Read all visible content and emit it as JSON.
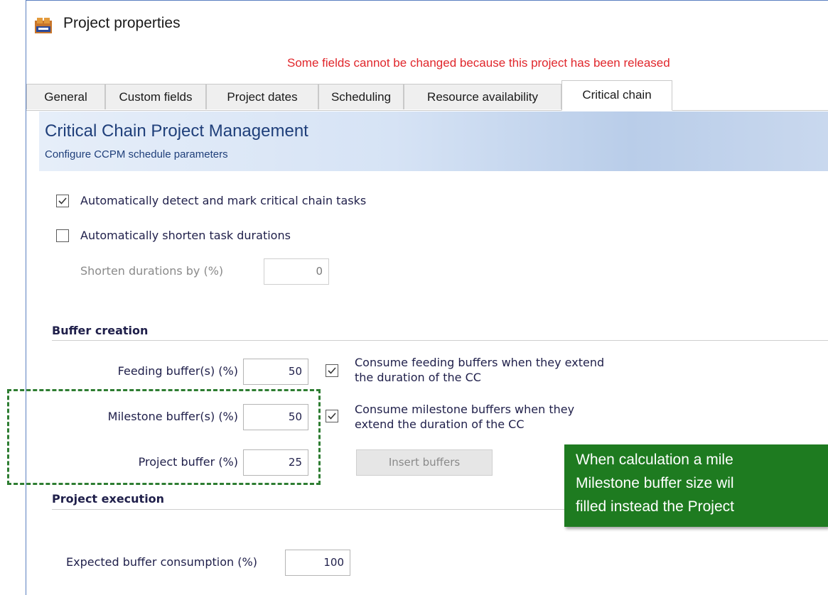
{
  "window": {
    "title": "Project properties",
    "warning": "Some fields cannot be changed because this project has been released"
  },
  "tabs": [
    {
      "label": "General",
      "active": false
    },
    {
      "label": "Custom fields",
      "active": false
    },
    {
      "label": "Project dates",
      "active": false
    },
    {
      "label": "Scheduling",
      "active": false
    },
    {
      "label": "Resource availability",
      "active": false
    },
    {
      "label": "Critical chain",
      "active": true
    }
  ],
  "banner": {
    "title": "Critical Chain Project Management",
    "subtitle": "Configure CCPM schedule parameters"
  },
  "options": {
    "auto_detect": {
      "label": "Automatically detect and mark critical chain tasks",
      "checked": true
    },
    "auto_shorten": {
      "label": "Automatically shorten task durations",
      "checked": false
    },
    "shorten_by": {
      "label": "Shorten durations by (%)",
      "value": "0"
    }
  },
  "buffer_creation": {
    "heading": "Buffer creation",
    "feeding": {
      "label": "Feeding buffer(s) (%)",
      "value": "50"
    },
    "milestone": {
      "label": "Milestone buffer(s) (%)",
      "value": "50"
    },
    "project": {
      "label": "Project buffer (%)",
      "value": "25"
    },
    "consume_feeding": {
      "line1": "Consume feeding buffers when they extend",
      "line2": "the duration of the CC",
      "checked": true
    },
    "consume_milestone": {
      "line1": "Consume milestone buffers when they",
      "line2": "extend the duration of the CC",
      "checked": true
    },
    "insert_buttons_label": "Insert buffers"
  },
  "project_execution": {
    "heading": "Project execution",
    "expected": {
      "label": "Expected buffer consumption (%)",
      "value": "100"
    }
  },
  "callout": {
    "line1": "When calculation a mile",
    "line2": "Milestone buffer size wil",
    "line3": "filled instead the Project"
  },
  "colors": {
    "warning": "#e0262b",
    "callout_bg": "#1e7b20",
    "highlight_border": "#2e7d32",
    "banner_text": "#1f3f7a"
  }
}
